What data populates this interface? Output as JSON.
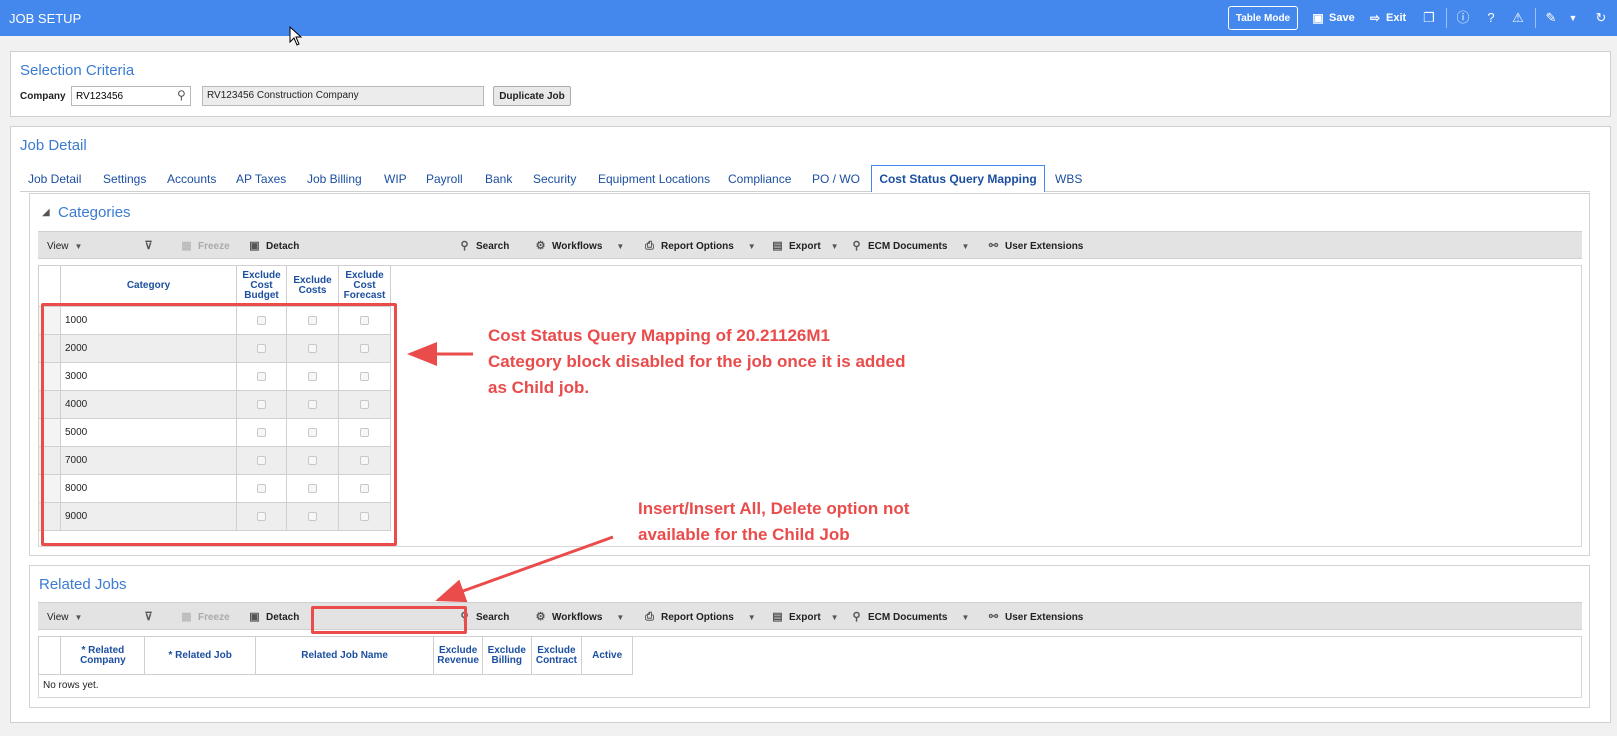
{
  "app": {
    "title": "JOB SETUP",
    "toolbar": {
      "table_mode": "Table Mode",
      "save": "Save",
      "exit": "Exit"
    }
  },
  "selection": {
    "title": "Selection Criteria",
    "company_label": "Company",
    "company_value": "RV123456",
    "company_name": "RV123456  Construction Company",
    "duplicate_button": "Duplicate Job"
  },
  "job_detail": {
    "title": "Job Detail",
    "tabs": [
      "Job Detail",
      "Settings",
      "Accounts",
      "AP Taxes",
      "Job Billing",
      "WIP",
      "Payroll",
      "Bank",
      "Security",
      "Equipment Locations",
      "Compliance",
      "PO / WO",
      "Cost Status Query Mapping",
      "WBS"
    ],
    "active_tab": "Cost Status Query Mapping"
  },
  "grid_toolbar": {
    "view": "View",
    "freeze": "Freeze",
    "detach": "Detach",
    "search": "Search",
    "workflows": "Workflows",
    "report_options": "Report Options",
    "export": "Export",
    "ecm_documents": "ECM Documents",
    "user_extensions": "User Extensions"
  },
  "categories": {
    "title": "Categories",
    "columns": [
      "Category",
      "Exclude Cost Budget",
      "Exclude Costs",
      "Exclude Cost Forecast"
    ],
    "rows": [
      "1000",
      "2000",
      "3000",
      "4000",
      "5000",
      "7000",
      "8000",
      "9000"
    ]
  },
  "related_jobs": {
    "title": "Related Jobs",
    "columns": [
      "* Related Company",
      "* Related Job",
      "Related Job Name",
      "Exclude Revenue",
      "Exclude Billing",
      "Exclude Contract",
      "Active"
    ],
    "empty": "No rows yet."
  },
  "annotations": {
    "a1_line1": "Cost Status Query Mapping of 20.21126M1",
    "a1_line2": "Category block disabled for the job once it is added",
    "a1_line3": "as Child job.",
    "a2_line1": "Insert/Insert All, Delete option not",
    "a2_line2": "available for the Child Job"
  },
  "colors": {
    "titlebar": "#4488ee",
    "annotation": "#ea4b4b",
    "section_title": "#3b7bd2"
  }
}
